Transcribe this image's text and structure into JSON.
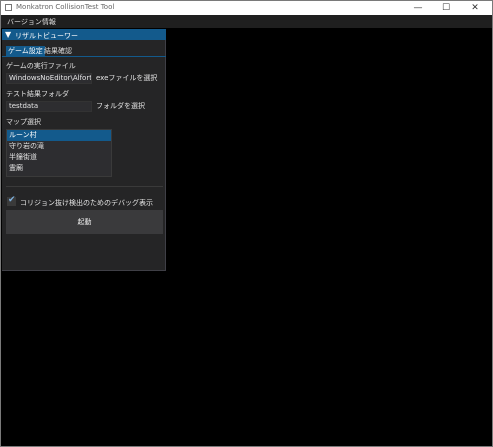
{
  "window": {
    "title": "Monkatron CollisionTest Tool"
  },
  "titlebar_controls": {
    "minimize": "—",
    "maximize": "☐",
    "close": "✕"
  },
  "menubar": {
    "items": [
      "バージョン情報"
    ]
  },
  "panel": {
    "header": "リザルトビューワー",
    "tabs": [
      "ゲーム設定",
      "結果確認"
    ],
    "game_exe_label": "ゲームの実行ファイル",
    "game_exe_value": "WindowsNoEditor\\Alfort.ex",
    "game_exe_button": "exeファイルを選択",
    "result_folder_label": "テスト結果フォルダ",
    "result_folder_value": "testdata",
    "result_folder_button": "フォルダを選択",
    "map_label": "マップ選択",
    "maps": [
      "ルーン村",
      "守り岩の滝",
      "半鐘街道",
      "霊廟"
    ],
    "debug_checkbox_label": "コリジョン抜け検出のためのデバッグ表示",
    "launch_button": "起動"
  },
  "colors": {
    "accent": "#135a8c",
    "panel_bg": "#252526",
    "field_bg": "#2d2d30"
  }
}
